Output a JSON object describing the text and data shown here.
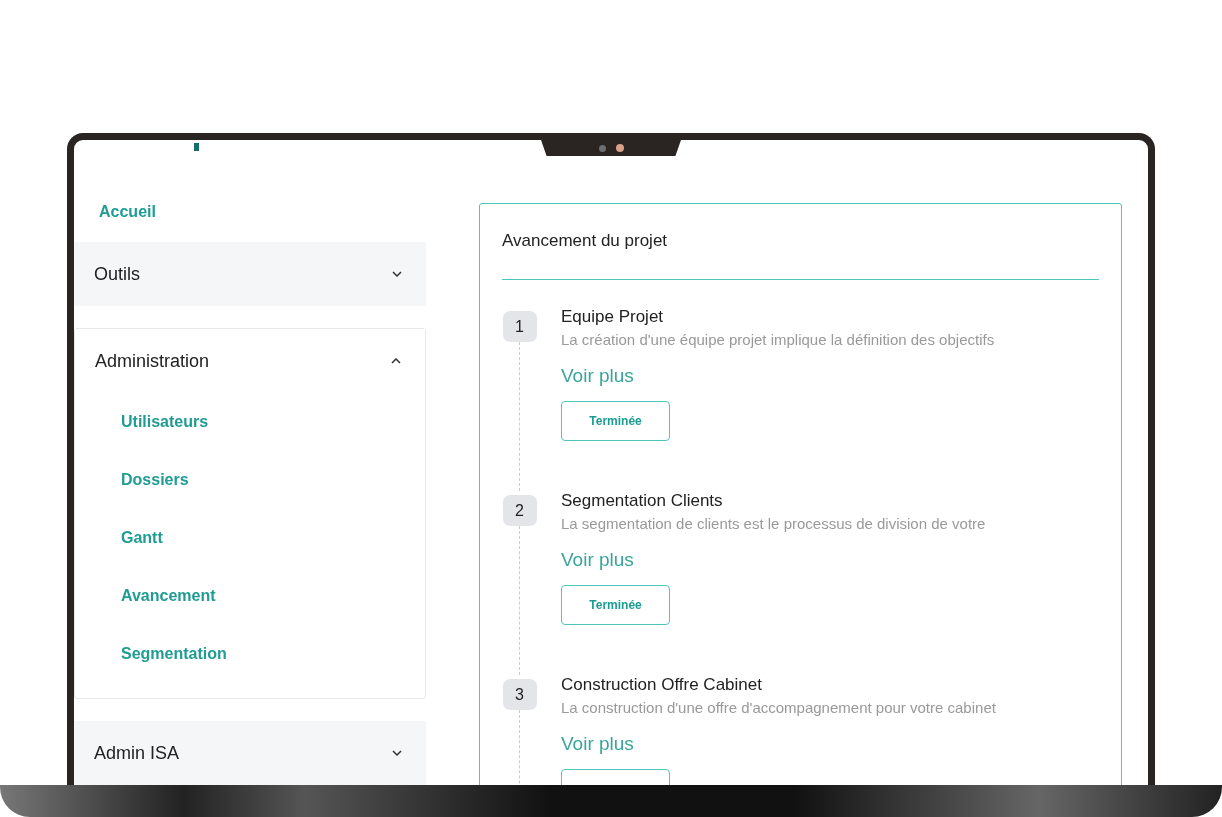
{
  "sidebar": {
    "home": "Accueil",
    "sections": [
      {
        "label": "Outils",
        "expanded": false
      },
      {
        "label": "Administration",
        "expanded": true,
        "children": [
          {
            "label": "Utilisateurs"
          },
          {
            "label": "Dossiers"
          },
          {
            "label": "Gantt"
          },
          {
            "label": "Avancement"
          },
          {
            "label": "Segmentation"
          }
        ]
      },
      {
        "label": "Admin ISA",
        "expanded": false
      }
    ]
  },
  "progress": {
    "title": "Avancement du projet",
    "steps": [
      {
        "number": "1",
        "title": "Equipe Projet",
        "description": "La création d'une équipe projet implique la définition des objectifs",
        "link": "Voir plus",
        "status": "Terminée"
      },
      {
        "number": "2",
        "title": "Segmentation Clients",
        "description": "La segmentation de clients est le processus de division de votre",
        "link": "Voir plus",
        "status": "Terminée"
      },
      {
        "number": "3",
        "title": "Construction Offre Cabinet",
        "description": "La construction d'une offre d'accompagnement pour votre cabinet",
        "link": "Voir plus"
      }
    ]
  }
}
